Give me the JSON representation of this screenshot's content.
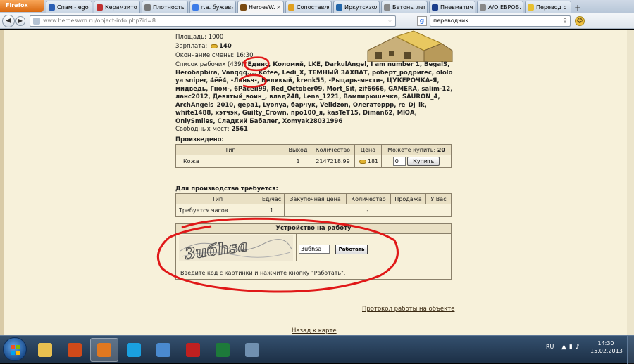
{
  "browser": {
    "menu_label": "Firefox",
    "tabs": [
      {
        "label": "Спам - egor...",
        "color": "#2b5fb4",
        "active": false
      },
      {
        "label": "Керамзито...",
        "color": "#c03030",
        "active": false
      },
      {
        "label": "Плотность ...",
        "color": "#777777",
        "active": false
      },
      {
        "label": "г.а. бужеви...",
        "color": "#3b7be8",
        "active": false
      },
      {
        "label": "HeroesW...",
        "color": "#7a4a10",
        "active": true
      },
      {
        "label": "Сопоставле...",
        "color": "#e0a020",
        "active": false
      },
      {
        "label": "Иркутскзол...",
        "color": "#2266aa",
        "active": false
      },
      {
        "label": "Бетоны лег...",
        "color": "#888888",
        "active": false
      },
      {
        "label": "Пневматич...",
        "color": "#1b3e8c",
        "active": false
      },
      {
        "label": "А/О ЕВРОБ...",
        "color": "#888888",
        "active": false
      },
      {
        "label": "Перевод с а...",
        "color": "#e8c030",
        "active": false
      }
    ],
    "url": "www.heroeswm.ru/object-info.php?id=8",
    "search_value": "переводчик"
  },
  "page": {
    "area": "Площадь: 1000",
    "salary_label": "Зарплата:",
    "salary_value": "140",
    "shift_end": "Окончание смены: 16:30",
    "workers_label": "Список рабочих (439):",
    "workers_list": "Единс, Коломий, LKE, DarkulAngel, I am number 1, BegalS, Herобарbira, Vanqqq..., Kofee, Ledi_X, ТЕМНЫЙ ЗАХВАТ, роберт_родригес, ololo ya sniper, 4ёё4, -Линьч-, Великый, krenk55, -Рыцарь-мести-, ЦУКЕРОЧКА-Я, мидведь, Гном-, 6Расен99, Red_October09, Mort_Sit, zif6666, GAMERA, salim-12, ланс2012, Девятый_воин_, влад248, Lena_1221, Вампирюшечка, SAURON_4, ArchAngels_2010, gepa1, Lyonya, барчук, Velidzon, Олегаторpp, re_DJ_lk, white1488, хэтчэк, Guilty_Crown, про100_я, kasTeT15, Diman62, МЮА, OnlySmiles, Сладкий Бабалег, Xomyak28031996",
    "free_label": "Свободных мест:",
    "free_value": "2561",
    "produced_title": "Произведено:",
    "produced_table": {
      "headers": [
        "Тип",
        "Выход",
        "Количество",
        "Цена",
        "Можете купить:"
      ],
      "can_buy": "20",
      "row": {
        "type": "Кожа",
        "output": "1",
        "quantity": "2147218.99",
        "price": "181",
        "qty_input": "0",
        "buy_button": "Купить"
      }
    },
    "required_title": "Для производства требуется:",
    "required_table": {
      "headers": [
        "Тип",
        "Ед/час",
        "Закупочная цена",
        "Количество",
        "Продажа",
        "У Вас"
      ],
      "row": {
        "type": "Требуется часов",
        "per_hour": "1",
        "quantity": "-"
      }
    },
    "hire": {
      "title": "Устройство на работу",
      "captcha_text": "3uбhsa",
      "input_value": "3uбhsa",
      "button": "Работать",
      "hint": "Введите код с картинки и нажмите кнопку \"Работать\"."
    },
    "protocol_link": "Протокол работы на объекте",
    "back_link": "Назад к карте"
  },
  "taskbar": {
    "language": "RU",
    "time": "14:30",
    "date": "15.02.2013",
    "apps": [
      {
        "name": "explorer",
        "color": "#e8c050",
        "active": false
      },
      {
        "name": "media",
        "color": "#d04a1a",
        "active": false
      },
      {
        "name": "firefox",
        "color": "#e07820",
        "active": true
      },
      {
        "name": "skype",
        "color": "#1aa0e0",
        "active": false
      },
      {
        "name": "tool",
        "color": "#4a8ad0",
        "active": false
      },
      {
        "name": "pdf",
        "color": "#c02020",
        "active": false
      },
      {
        "name": "excel",
        "color": "#1d7a3a",
        "active": false
      },
      {
        "name": "window",
        "color": "#7090b0",
        "active": false
      }
    ]
  }
}
